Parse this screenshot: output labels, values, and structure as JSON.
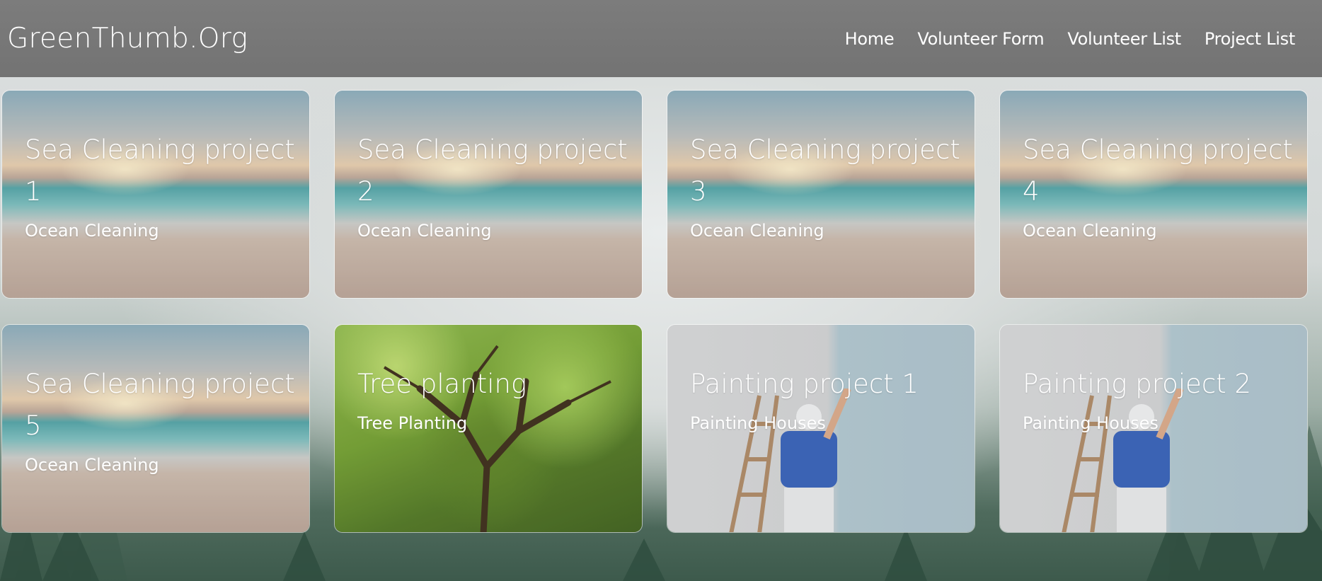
{
  "navbar": {
    "brand": "GreenThumb.Org",
    "links": [
      "Home",
      "Volunteer Form",
      "Volunteer List",
      "Project List"
    ]
  },
  "projects": [
    {
      "title": "Sea Cleaning project 1",
      "category": "Ocean Cleaning",
      "image": "beach-sunset"
    },
    {
      "title": "Sea Cleaning project 2",
      "category": "Ocean Cleaning",
      "image": "beach-sunset"
    },
    {
      "title": "Sea Cleaning project 3",
      "category": "Ocean Cleaning",
      "image": "beach-sunset"
    },
    {
      "title": "Sea Cleaning project 4",
      "category": "Ocean Cleaning",
      "image": "beach-sunset"
    },
    {
      "title": "Sea Cleaning project 5",
      "category": "Ocean Cleaning",
      "image": "beach-sunset"
    },
    {
      "title": "Tree planting",
      "category": "Tree Planting",
      "image": "tree-canopy"
    },
    {
      "title": "Painting project 1",
      "category": "Painting Houses",
      "image": "painter-wall"
    },
    {
      "title": "Painting project 2",
      "category": "Painting Houses",
      "image": "painter-wall"
    }
  ]
}
